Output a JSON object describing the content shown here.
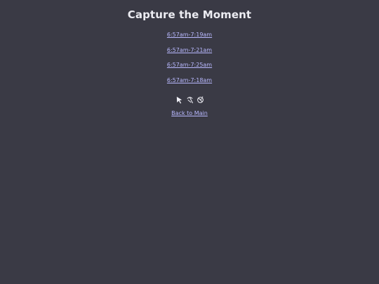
{
  "page": {
    "title": "Capture the Moment"
  },
  "links": [
    {
      "label": "6:57am-7:19am"
    },
    {
      "label": "6:57am-7:21am"
    },
    {
      "label": "6:57am-7:25am"
    },
    {
      "label": "6:57am-7:18am"
    }
  ],
  "icons": [
    "arrow-cursor-icon",
    "pickaxe-icon",
    "compass-icon"
  ],
  "footer": {
    "back_label": "Back to Main"
  }
}
